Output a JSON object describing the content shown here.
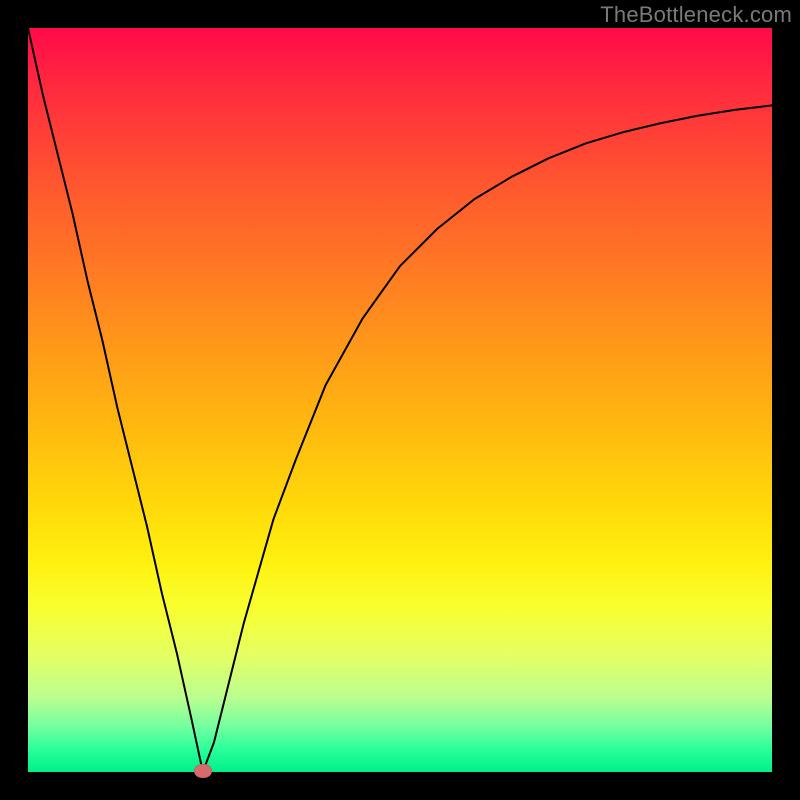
{
  "watermark": "TheBottleneck.com",
  "chart_data": {
    "type": "line",
    "title": "",
    "xlabel": "",
    "ylabel": "",
    "xlim": [
      0,
      100
    ],
    "ylim": [
      0,
      100
    ],
    "grid": false,
    "background_gradient": {
      "direction": "vertical",
      "stops": [
        {
          "pos": 0,
          "color": "#ff0a4a"
        },
        {
          "pos": 50,
          "color": "#ffb410"
        },
        {
          "pos": 75,
          "color": "#f8ff30"
        },
        {
          "pos": 100,
          "color": "#00f08a"
        }
      ]
    },
    "series": [
      {
        "name": "bottleneck-curve",
        "color": "#000000",
        "x": [
          0,
          2,
          4,
          6,
          8,
          10,
          12,
          14,
          16,
          18,
          20,
          22,
          23.5,
          25,
          27,
          29,
          31,
          33,
          36,
          40,
          45,
          50,
          55,
          60,
          65,
          70,
          75,
          80,
          85,
          90,
          95,
          100
        ],
        "y": [
          100,
          91,
          83,
          75,
          66,
          58,
          49,
          41,
          33,
          24,
          16,
          7,
          0,
          4,
          12,
          20,
          27,
          34,
          42,
          52,
          61,
          68,
          73,
          77,
          80,
          82.5,
          84.5,
          86,
          87.2,
          88.2,
          89,
          89.6
        ]
      }
    ],
    "annotations": [
      {
        "name": "min-marker",
        "shape": "ellipse",
        "color": "#d66b6b",
        "x": 23.5,
        "y": 0
      }
    ]
  },
  "colors": {
    "frame": "#000000",
    "curve": "#000000",
    "marker": "#d66b6b",
    "watermark": "#7a7a7a"
  }
}
